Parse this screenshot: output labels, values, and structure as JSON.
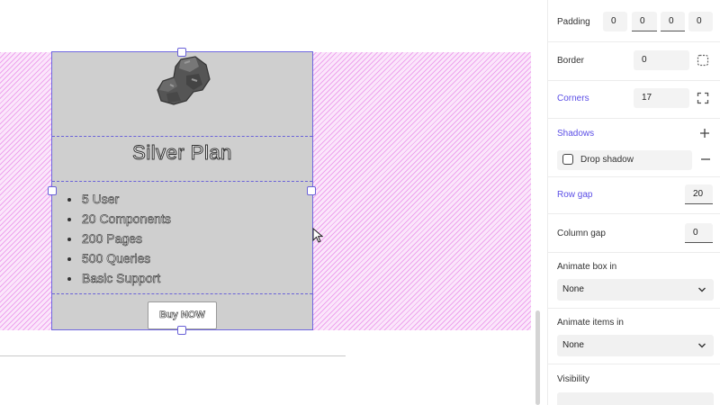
{
  "card": {
    "title": "Silver Plan",
    "features": [
      "5 User",
      "20 Components",
      "200 Pages",
      "500 Queries",
      "Basic Support"
    ],
    "button_label": "Buy NOW"
  },
  "panel": {
    "padding": {
      "label": "Padding",
      "values": [
        "0",
        "0",
        "0",
        "0"
      ]
    },
    "border": {
      "label": "Border",
      "value": "0"
    },
    "corners": {
      "label": "Corners",
      "value": "17"
    },
    "shadows": {
      "label": "Shadows",
      "item": "Drop shadow"
    },
    "row_gap": {
      "label": "Row gap",
      "value": "20"
    },
    "column_gap": {
      "label": "Column gap",
      "value": "0"
    },
    "animate_box": {
      "label": "Animate box in",
      "value": "None"
    },
    "animate_items": {
      "label": "Animate items in",
      "value": "None"
    },
    "visibility": {
      "label": "Visibility"
    }
  },
  "colors": {
    "accent": "#5b4ee6",
    "selection": "#6a62d8",
    "band": "#e26ee2",
    "card": "#cfcfcf"
  },
  "icons": [
    "rock-image",
    "cursor-icon",
    "border-style-icon",
    "corners-expand-icon",
    "plus-icon",
    "minus-icon",
    "chevron-down-icon"
  ]
}
